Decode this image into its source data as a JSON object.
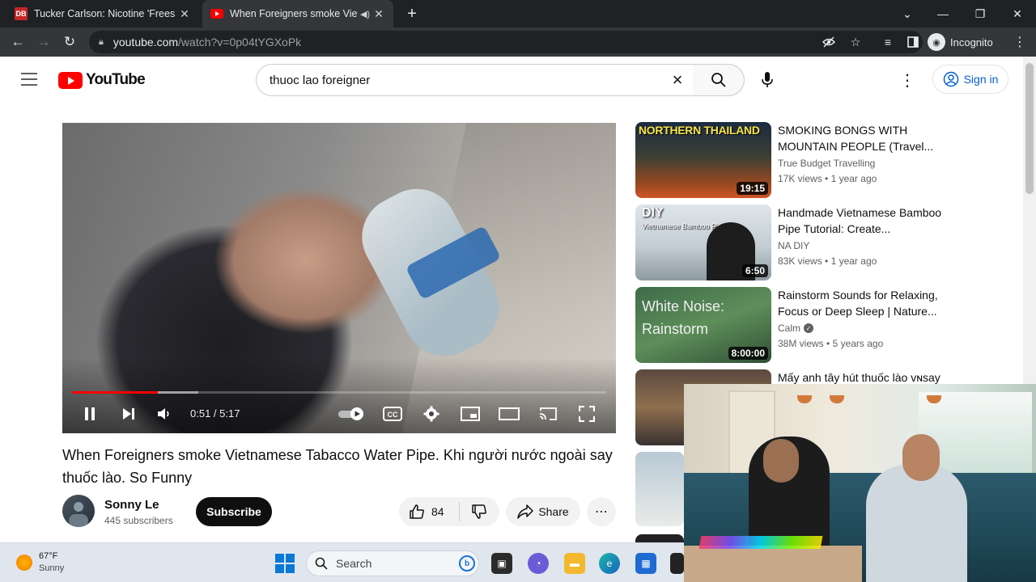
{
  "tabs": [
    {
      "favicon": "db-icon",
      "title": "Tucker Carlson: Nicotine 'Frees Yo",
      "active": false
    },
    {
      "favicon": "youtube-icon",
      "title": "When Foreigners smoke Viet",
      "active": true
    }
  ],
  "toolbar": {
    "url_host": "youtube.com",
    "url_path": "/watch?v=0p04tYGXoPk",
    "incognito_label": "Incognito"
  },
  "header": {
    "logo_text": "YouTube",
    "search_value": "thuoc lao foreigner",
    "sign_in": "Sign in"
  },
  "player": {
    "time_display": "0:51 / 5:17",
    "progress_fraction": 0.1609,
    "buffered_fraction": 0.2366
  },
  "video": {
    "title": "When Foreigners smoke Vietnamese Tabacco Water Pipe. Khi người nước ngoài say thuốc lào. So Funny",
    "channel": "Sonny Le",
    "subscribers": "445 subscribers",
    "subscribe_label": "Subscribe",
    "likes": "84",
    "share_label": "Share"
  },
  "recommendations": [
    {
      "thumb_text": "NORTHERN THAILAND",
      "duration": "19:15",
      "title": "SMOKING BONGS WITH MOUNTAIN PEOPLE (Travel...",
      "channel": "True Budget Travelling",
      "verified": false,
      "views": "17K views",
      "age": "1 year ago"
    },
    {
      "thumb_text": "DIY",
      "thumb_sub": "Vietnamese Bamboo Pipe",
      "duration": "6:50",
      "title": "Handmade Vietnamese Bamboo Pipe Tutorial: Create...",
      "channel": "NA DIY",
      "verified": false,
      "views": "83K views",
      "age": "1 year ago"
    },
    {
      "thumb_text": "White Noise: Rainstorm",
      "duration": "8:00:00",
      "title": "Rainstorm Sounds for Relaxing, Focus or Deep Sleep | Nature...",
      "channel": "Calm",
      "verified": true,
      "views": "38M views",
      "age": "5 years ago"
    },
    {
      "title": "Mấy anh tây hút thuốc lào ᴠɴsay"
    }
  ],
  "taskbar": {
    "temperature": "67°F",
    "condition": "Sunny",
    "search_label": "Search"
  },
  "colors": {
    "youtube_red": "#ff0000",
    "link_blue": "#065fd4",
    "chrome_dark": "#202124",
    "chrome_toolbar": "#35363a"
  }
}
